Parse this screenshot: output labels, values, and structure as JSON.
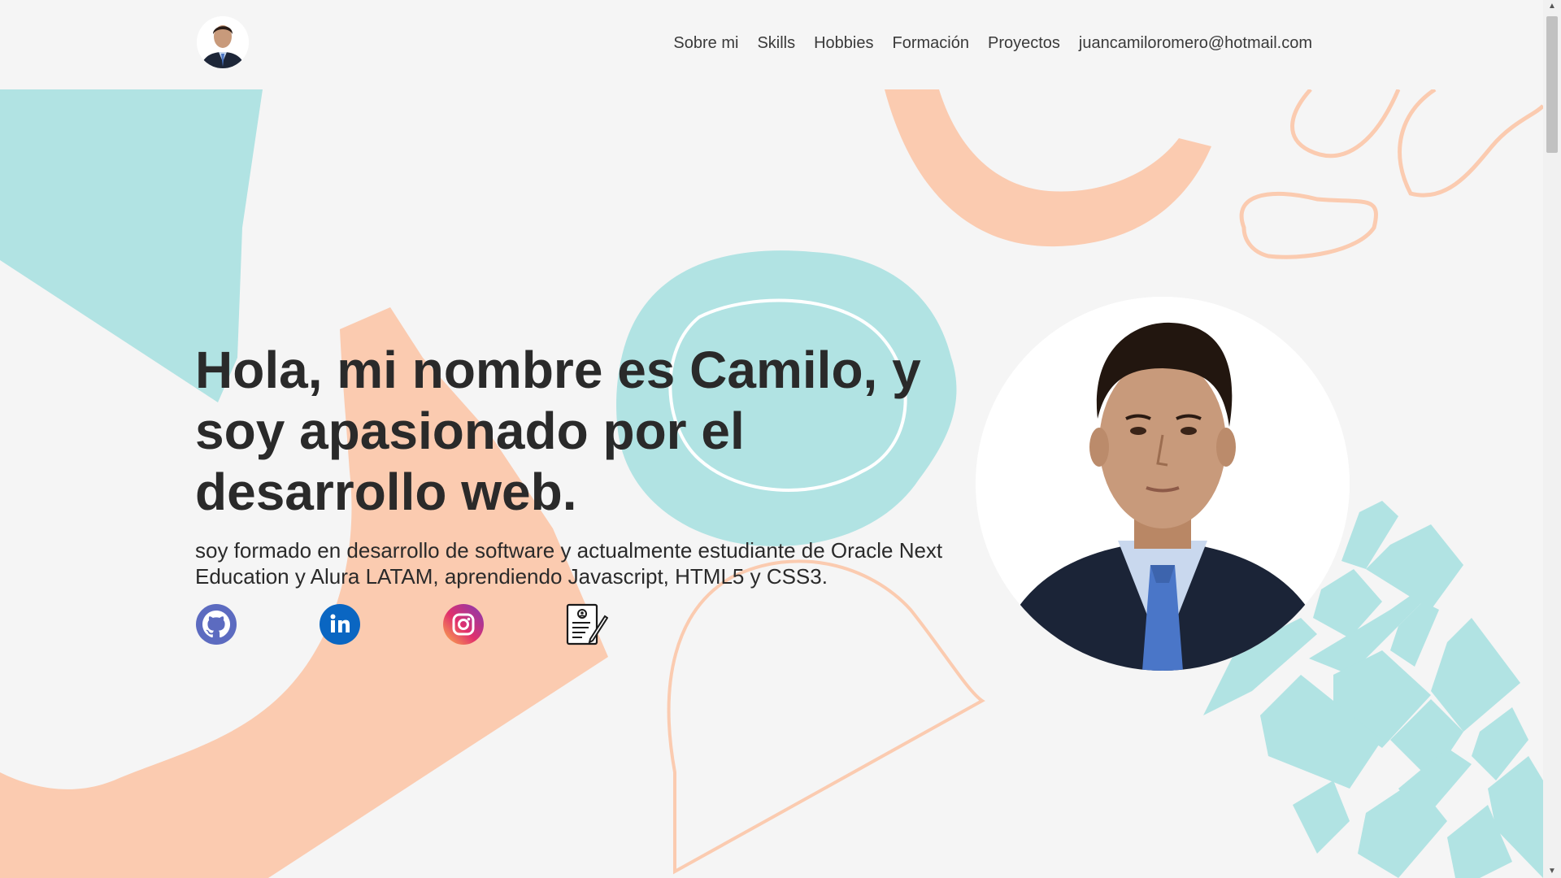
{
  "header": {
    "nav": [
      {
        "label": "Sobre mi"
      },
      {
        "label": "Skills"
      },
      {
        "label": "Hobbies"
      },
      {
        "label": "Formación"
      },
      {
        "label": "Proyectos"
      },
      {
        "label": "juancamiloromero@hotmail.com"
      }
    ]
  },
  "hero": {
    "title": "Hola, mi nombre es Camilo, y soy apasionado por el desarrollo web.",
    "subtitle": "soy formado en desarrollo de software y actualmente estudiante de Oracle Next Education y Alura LATAM, aprendiendo Javascript, HTML5 y CSS3."
  },
  "socials": [
    {
      "icon": "github-icon"
    },
    {
      "icon": "linkedin-icon"
    },
    {
      "icon": "instagram-icon"
    },
    {
      "icon": "resume-icon"
    }
  ],
  "colors": {
    "teal": "#b1e3e3",
    "peach": "#fbcbb0",
    "background": "#f5f5f5",
    "text": "#2a2a2a",
    "github": "#5c6bc0",
    "linkedin": "#0a66c2"
  }
}
